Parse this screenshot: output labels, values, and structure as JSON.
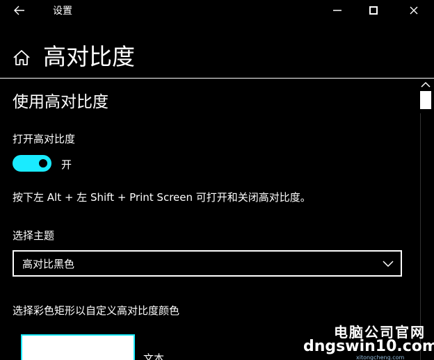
{
  "window": {
    "title": "设置"
  },
  "header": {
    "title": "高对比度"
  },
  "section": {
    "title": "使用高对比度",
    "toggle_label": "打开高对比度",
    "toggle_state": "开",
    "shortcut_text": "按下左 Alt + 左 Shift + Print Screen 可打开和关闭高对比度。",
    "theme_label": "选择主题",
    "theme_value": "高对比黑色",
    "color_label": "选择彩色矩形以自定义高对比度颜色",
    "swatch_label": "文本"
  },
  "watermark": {
    "line1": "电脑公司官网",
    "line2": "dngswin10.com",
    "line3": "xitongcheng.com"
  },
  "colors": {
    "accent": "#1aebff",
    "background": "#000000",
    "foreground": "#ffffff"
  },
  "icons": {
    "back": "back-arrow-icon",
    "minimize": "minimize-icon",
    "maximize": "maximize-icon",
    "close": "close-icon",
    "home": "home-icon",
    "dropdown": "chevron-down-icon"
  }
}
